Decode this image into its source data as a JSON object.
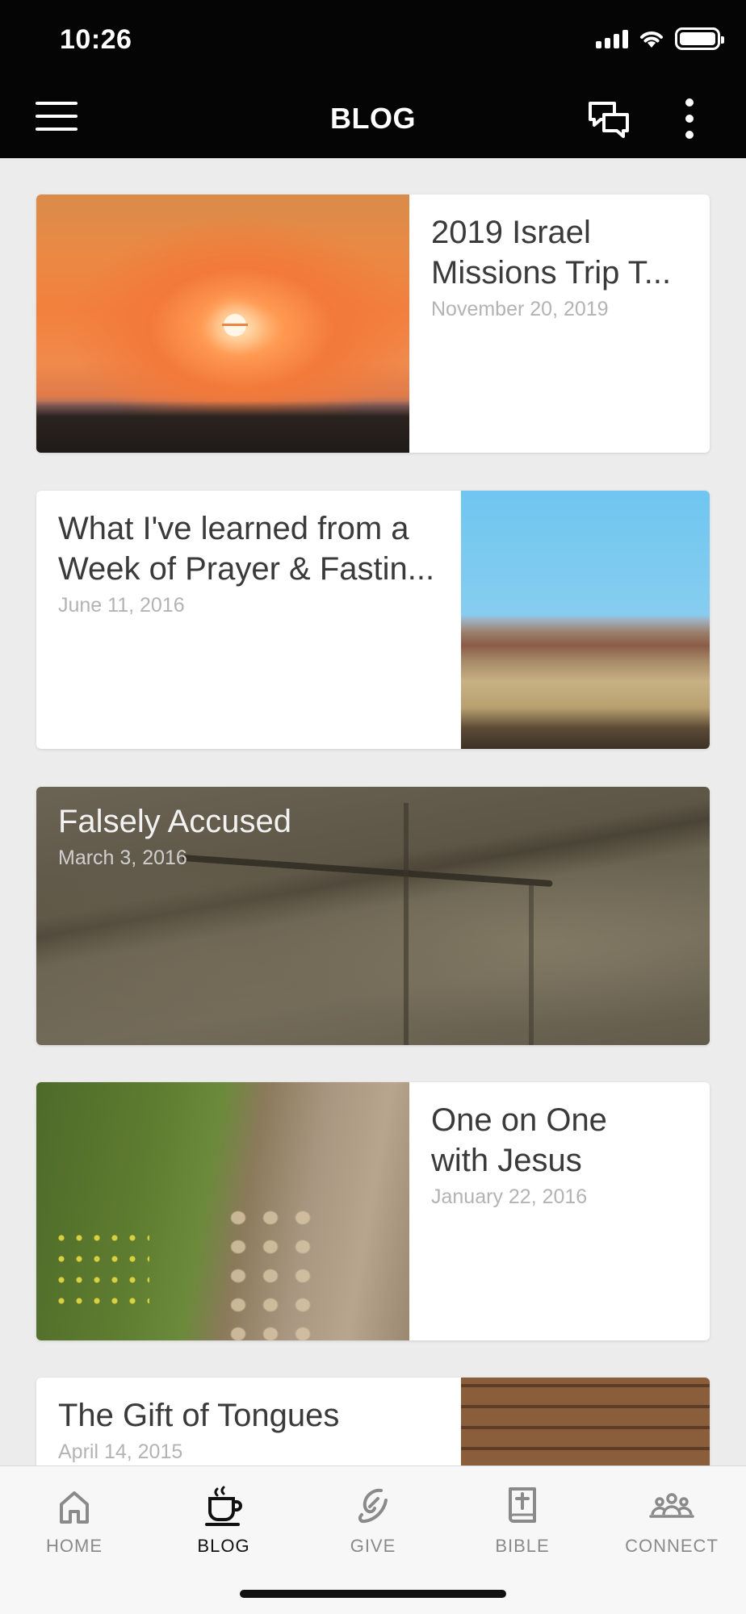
{
  "status_bar": {
    "time": "10:26"
  },
  "header": {
    "title": "BLOG",
    "menu_icon": "hamburger-menu-icon",
    "chat_icon": "chat-bubbles-icon",
    "more_icon": "vertical-ellipsis-icon"
  },
  "posts": [
    {
      "title": "2019 Israel Missions Trip T...",
      "title_lines": [
        "2019 Israel",
        "Missions Trip T..."
      ],
      "date": "November 20, 2019",
      "image": "sunset-landscape",
      "layout": "image-left"
    },
    {
      "title": "What I've learned from a Week of Prayer & Fastin...",
      "title_lines": [
        "What I've learned from a",
        "Week of Prayer & Fastin..."
      ],
      "date": "June 11, 2016",
      "image": "desert-canyon",
      "layout": "image-right"
    },
    {
      "title": "Falsely Accused",
      "title_lines": [
        "Falsely Accused"
      ],
      "date": "March 3, 2016",
      "image": "stone-rock",
      "layout": "image-background"
    },
    {
      "title": "One on One with Jesus",
      "title_lines": [
        "One on One",
        "with Jesus"
      ],
      "date": "January 22, 2016",
      "image": "dirt-path",
      "layout": "image-left"
    },
    {
      "title": "The Gift of Tongues",
      "title_lines": [
        "The Gift of Tongues"
      ],
      "date": "April 14, 2015",
      "image": "stone-arch",
      "layout": "image-right"
    }
  ],
  "tabs": [
    {
      "label": "HOME",
      "icon": "home-icon",
      "active": false
    },
    {
      "label": "BLOG",
      "icon": "coffee-cup-icon",
      "active": true
    },
    {
      "label": "GIVE",
      "icon": "give-hand-icon",
      "active": false
    },
    {
      "label": "BIBLE",
      "icon": "bible-book-icon",
      "active": false
    },
    {
      "label": "CONNECT",
      "icon": "people-group-icon",
      "active": false
    }
  ]
}
